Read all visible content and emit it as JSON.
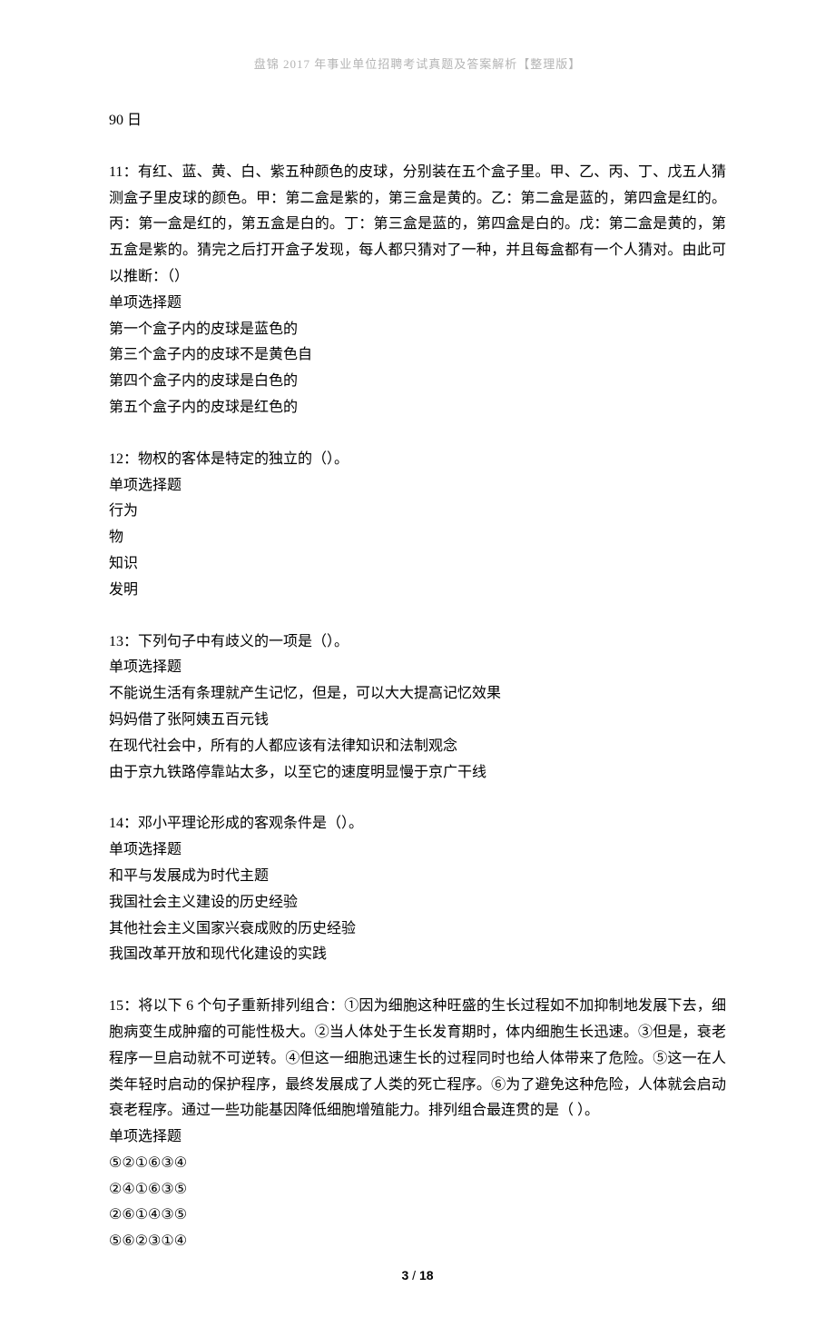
{
  "header": "盘锦 2017 年事业单位招聘考试真题及答案解析【整理版】",
  "top_line": "90 日",
  "questions": [
    {
      "stem": "11：有红、蓝、黄、白、紫五种颜色的皮球，分别装在五个盒子里。甲、乙、丙、丁、戊五人猜测盒子里皮球的颜色。甲：第二盒是紫的，第三盒是黄的。乙：第二盒是蓝的，第四盒是红的。丙：第一盒是红的，第五盒是白的。丁：第三盒是蓝的，第四盒是白的。戊：第二盒是黄的，第五盒是紫的。猜完之后打开盒子发现，每人都只猜对了一种，并且每盒都有一个人猜对。由此可以推断：（）",
      "type": "单项选择题",
      "options": [
        "第一个盒子内的皮球是蓝色的",
        "第三个盒子内的皮球不是黄色自",
        "第四个盒子内的皮球是白色的",
        "第五个盒子内的皮球是红色的"
      ]
    },
    {
      "stem": "12：物权的客体是特定的独立的（）。",
      "type": "单项选择题",
      "options": [
        "行为",
        "物",
        "知识",
        "发明"
      ]
    },
    {
      "stem": "13：下列句子中有歧义的一项是（）。",
      "type": "单项选择题",
      "options": [
        "不能说生活有条理就产生记忆，但是，可以大大提高记忆效果",
        "妈妈借了张阿姨五百元钱",
        "在现代社会中，所有的人都应该有法律知识和法制观念",
        "由于京九铁路停靠站太多，以至它的速度明显慢于京广干线"
      ]
    },
    {
      "stem": "14：邓小平理论形成的客观条件是（）。",
      "type": "单项选择题",
      "options": [
        "和平与发展成为时代主题",
        "我国社会主义建设的历史经验",
        "其他社会主义国家兴衰成败的历史经验",
        "我国改革开放和现代化建设的实践"
      ]
    },
    {
      "stem": "15：将以下 6 个句子重新排列组合：①因为细胞这种旺盛的生长过程如不加抑制地发展下去，细胞病变生成肿瘤的可能性极大。②当人体处于生长发育期时，体内细胞生长迅速。③但是，衰老程序一旦启动就不可逆转。④但这一细胞迅速生长的过程同时也给人体带来了危险。⑤这一在人类年轻时启动的保护程序，最终发展成了人类的死亡程序。⑥为了避免这种危险，人体就会启动衰老程序。通过一些功能基因降低细胞增殖能力。排列组合最连贯的是（ ）。",
      "type": "单项选择题",
      "options": [
        "⑤②①⑥③④",
        "②④①⑥③⑤",
        "②⑥①④③⑤",
        "⑤⑥②③①④"
      ]
    }
  ],
  "footer": {
    "page": "3",
    "total": "18"
  }
}
